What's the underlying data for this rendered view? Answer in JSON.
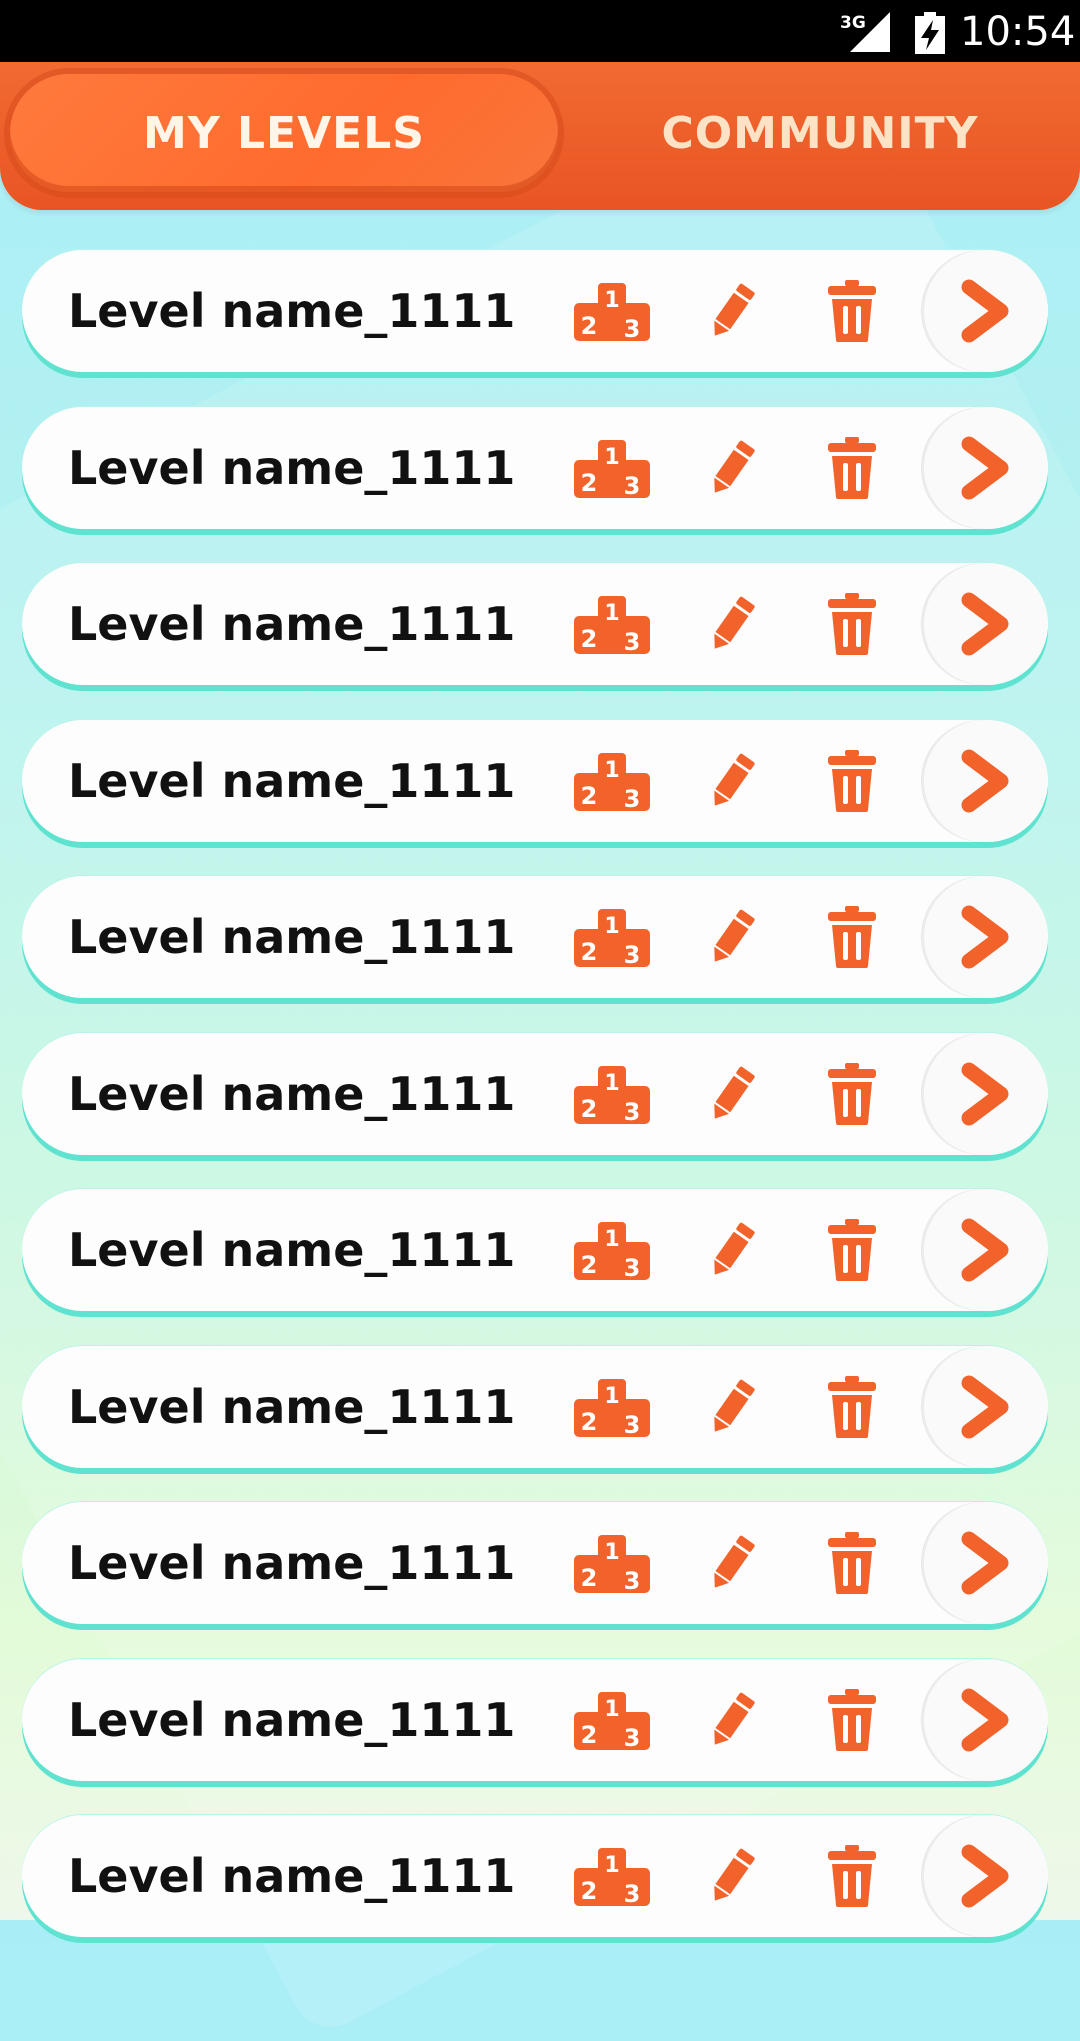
{
  "status_bar": {
    "network": "3G",
    "time": "10:54",
    "signal_icon": "cell-signal-icon",
    "battery_icon": "battery-charging-icon"
  },
  "tabs": {
    "active": {
      "label": "MY LEVELS"
    },
    "inactive": {
      "label": "COMMUNITY"
    }
  },
  "colors": {
    "accent": "#f2632b",
    "row_border": "#5fe3d0"
  },
  "levels": [
    {
      "name": "Level name_1111"
    },
    {
      "name": "Level name_1111"
    },
    {
      "name": "Level name_1111"
    },
    {
      "name": "Level name_1111"
    },
    {
      "name": "Level name_1111"
    },
    {
      "name": "Level name_1111"
    },
    {
      "name": "Level name_1111"
    },
    {
      "name": "Level name_1111"
    },
    {
      "name": "Level name_1111"
    },
    {
      "name": "Level name_1111"
    },
    {
      "name": "Level name_1111"
    }
  ],
  "row_icons": {
    "leaderboard": "podium-icon",
    "edit": "pencil-icon",
    "delete": "trash-icon",
    "play": "chevron-right-icon"
  }
}
